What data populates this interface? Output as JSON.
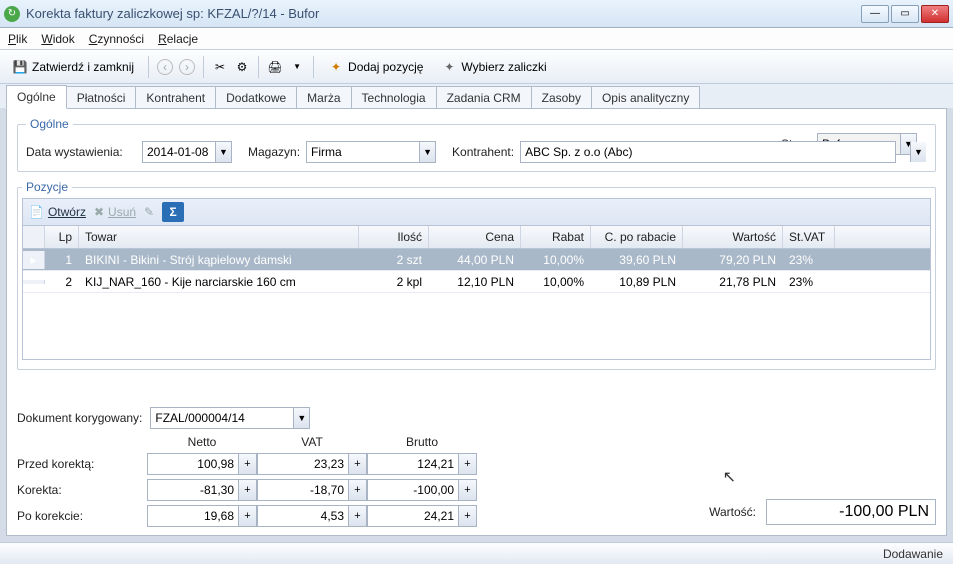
{
  "window": {
    "title": "Korekta faktury zaliczkowej sp: KFZAL/?/14 - Bufor"
  },
  "menu": {
    "plik": "Plik",
    "widok": "Widok",
    "czynnosci": "Czynności",
    "relacje": "Relacje"
  },
  "toolbar": {
    "save": "Zatwierdź i zamknij",
    "add_pos": "Dodaj pozycję",
    "choose_adv": "Wybierz zaliczki"
  },
  "tabs": [
    "Ogólne",
    "Płatności",
    "Kontrahent",
    "Dodatkowe",
    "Marża",
    "Technologia",
    "Zadania CRM",
    "Zasoby",
    "Opis analityczny"
  ],
  "general": {
    "legend": "Ogólne",
    "stan_label": "Stan:",
    "stan_value": "Bufor",
    "date_label": "Data wystawienia:",
    "date_value": "2014-01-08",
    "magazyn_label": "Magazyn:",
    "magazyn_value": "Firma",
    "kontrahent_label": "Kontrahent:",
    "kontrahent_value": "ABC Sp. z o.o (Abc)"
  },
  "pozycje": {
    "legend": "Pozycje",
    "open": "Otwórz",
    "del": "Usuń",
    "cols": {
      "lp": "Lp",
      "towar": "Towar",
      "ilosc": "Ilość",
      "cena": "Cena",
      "rabat": "Rabat",
      "cpo": "C. po rabacie",
      "wartosc": "Wartość",
      "stvat": "St.VAT"
    },
    "rows": [
      {
        "lp": "1",
        "towar": "BIKINI - Bikini - Strój kąpielowy damski",
        "ilosc": "2 szt",
        "cena": "44,00 PLN",
        "rabat": "10,00%",
        "cpo": "39,60 PLN",
        "wartosc": "79,20 PLN",
        "stvat": "23%"
      },
      {
        "lp": "2",
        "towar": "KIJ_NAR_160 - Kije narciarskie 160 cm",
        "ilosc": "2 kpl",
        "cena": "12,10 PLN",
        "rabat": "10,00%",
        "cpo": "10,89 PLN",
        "wartosc": "21,78 PLN",
        "stvat": "23%"
      }
    ]
  },
  "doc": {
    "label": "Dokument korygowany:",
    "value": "FZAL/000004/14"
  },
  "summary": {
    "headers": {
      "netto": "Netto",
      "vat": "VAT",
      "brutto": "Brutto"
    },
    "rows": {
      "before": {
        "lbl": "Przed korektą:",
        "netto": "100,98",
        "vat": "23,23",
        "brutto": "124,21"
      },
      "corr": {
        "lbl": "Korekta:",
        "netto": "-81,30",
        "vat": "-18,70",
        "brutto": "-100,00"
      },
      "after": {
        "lbl": "Po korekcie:",
        "netto": "19,68",
        "vat": "4,53",
        "brutto": "24,21"
      }
    }
  },
  "total": {
    "label": "Wartość:",
    "value": "-100,00 PLN"
  },
  "status": {
    "mode": "Dodawanie"
  }
}
